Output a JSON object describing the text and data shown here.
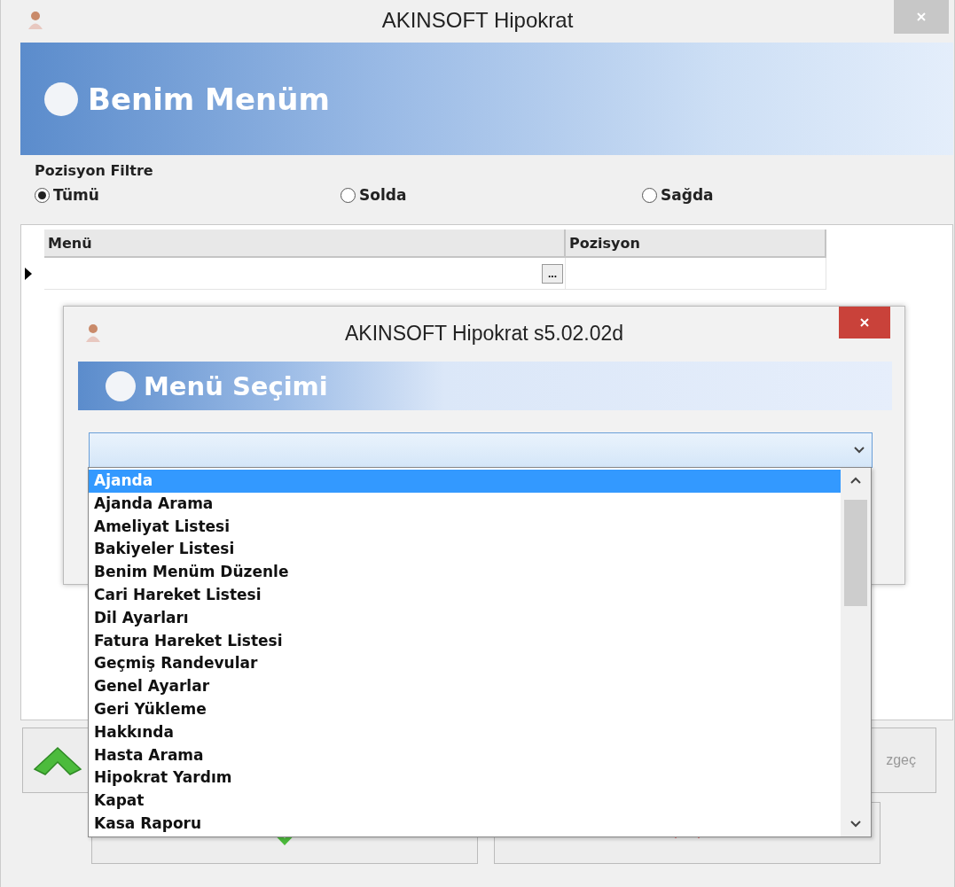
{
  "window": {
    "title": "AKINSOFT Hipokrat"
  },
  "header": {
    "title": "Benim Menüm"
  },
  "filter": {
    "label": "Pozisyon Filtre",
    "options": [
      {
        "label": "Tümü",
        "selected": true
      },
      {
        "label": "Solda",
        "selected": false
      },
      {
        "label": "Sağda",
        "selected": false
      }
    ]
  },
  "grid": {
    "columns": [
      "Menü",
      "Pozisyon"
    ],
    "ellipsis_button": "..."
  },
  "cancel_button": {
    "label": "zgeç"
  },
  "dialog": {
    "title": "AKINSOFT Hipokrat s5.02.02d",
    "header": "Menü Seçimi",
    "dropdown": {
      "items": [
        {
          "label": "Ajanda",
          "selected": true
        },
        {
          "label": "Ajanda Arama",
          "selected": false
        },
        {
          "label": "Ameliyat Listesi",
          "selected": false
        },
        {
          "label": "Bakiyeler Listesi",
          "selected": false
        },
        {
          "label": "Benim Menüm Düzenle",
          "selected": false
        },
        {
          "label": "Cari Hareket Listesi",
          "selected": false
        },
        {
          "label": "Dil Ayarları",
          "selected": false
        },
        {
          "label": "Fatura Hareket Listesi",
          "selected": false
        },
        {
          "label": "Geçmiş Randevular",
          "selected": false
        },
        {
          "label": "Genel Ayarlar",
          "selected": false
        },
        {
          "label": "Geri Yükleme",
          "selected": false
        },
        {
          "label": "Hakkında",
          "selected": false
        },
        {
          "label": "Hasta Arama",
          "selected": false
        },
        {
          "label": "Hipokrat Yardım",
          "selected": false
        },
        {
          "label": "Kapat",
          "selected": false
        },
        {
          "label": "Kasa Raporu",
          "selected": false
        }
      ]
    }
  }
}
